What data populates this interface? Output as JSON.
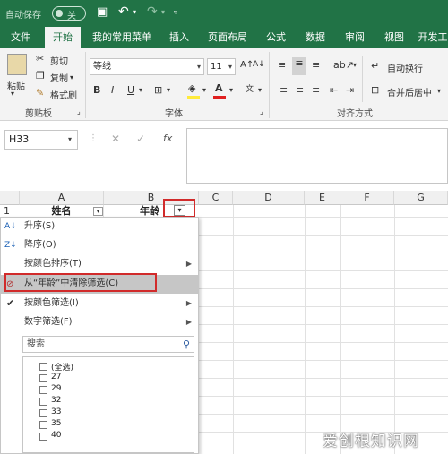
{
  "titlebar": {
    "autosave_label": "自动保存",
    "autosave_state": "关"
  },
  "tabs": [
    {
      "label": "文件"
    },
    {
      "label": "开始"
    },
    {
      "label": "我的常用菜单"
    },
    {
      "label": "插入"
    },
    {
      "label": "页面布局"
    },
    {
      "label": "公式"
    },
    {
      "label": "数据"
    },
    {
      "label": "审阅"
    },
    {
      "label": "视图"
    },
    {
      "label": "开发工"
    }
  ],
  "ribbon": {
    "clipboard": {
      "paste": "粘贴",
      "cut": "剪切",
      "copy": "复制",
      "format_painter": "格式刷",
      "group": "剪贴板"
    },
    "font": {
      "name": "等线",
      "size": "11",
      "group": "字体"
    },
    "alignment": {
      "wrap": "自动换行",
      "merge": "合并后居中",
      "group": "对齐方式"
    }
  },
  "formula_bar": {
    "name_box": "H33",
    "fx": "fx",
    "value": ""
  },
  "columns": [
    "A",
    "B",
    "C",
    "D",
    "E",
    "F",
    "G"
  ],
  "row1": {
    "num": "1",
    "a": "姓名",
    "b": "年龄"
  },
  "filter_menu": {
    "sort_asc": "升序(S)",
    "sort_desc": "降序(O)",
    "sort_color": "按颜色排序(T)",
    "clear_filter": "从“年龄”中清除筛选(C)",
    "filter_color": "按颜色筛选(I)",
    "number_filter": "数字筛选(F)",
    "search_placeholder": "搜索",
    "values": [
      "(全选)",
      "27",
      "29",
      "32",
      "33",
      "35",
      "40"
    ]
  },
  "watermark": "爱创根知识网",
  "colors": {
    "accent": "#217346",
    "highlight_box": "#d12b2b"
  }
}
